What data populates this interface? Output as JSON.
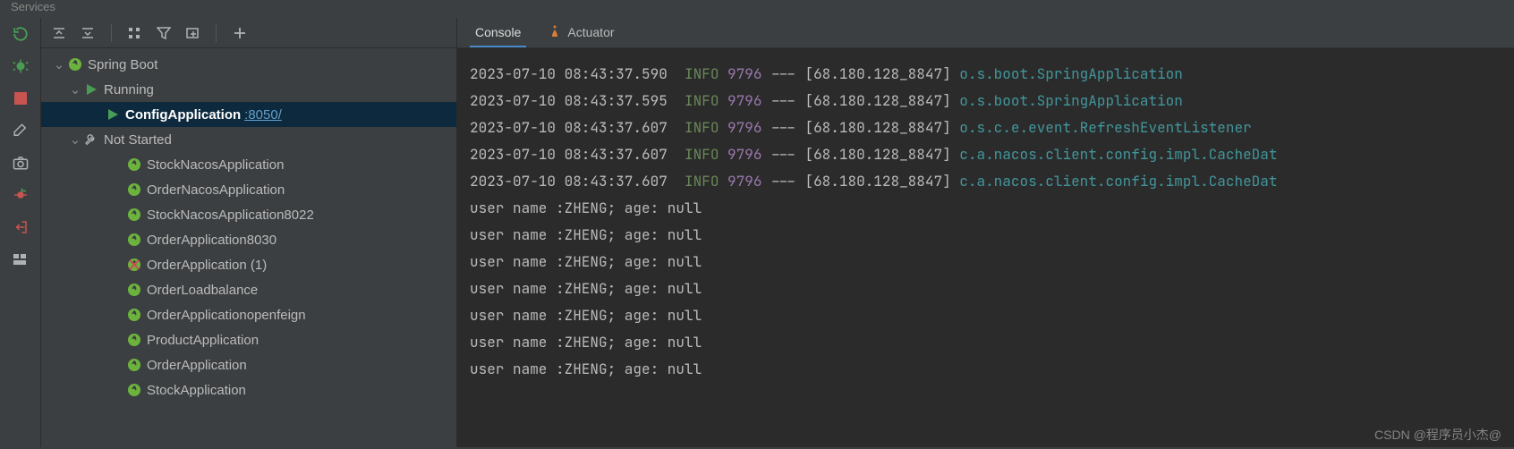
{
  "title": "Services",
  "tree": {
    "root": {
      "label": "Spring Boot"
    },
    "running": {
      "label": "Running"
    },
    "running_app": {
      "label": "ConfigApplication",
      "port": ":8050/"
    },
    "notstarted": {
      "label": "Not Started"
    },
    "apps": [
      {
        "label": "StockNacosApplication"
      },
      {
        "label": "OrderNacosApplication"
      },
      {
        "label": "StockNacosApplication8022"
      },
      {
        "label": "OrderApplication8030"
      },
      {
        "label": "OrderApplication (1)"
      },
      {
        "label": "OrderLoadbalance"
      },
      {
        "label": "OrderApplicationopenfeign"
      },
      {
        "label": "ProductApplication"
      },
      {
        "label": "OrderApplication"
      },
      {
        "label": "StockApplication"
      }
    ]
  },
  "tabs": {
    "console": "Console",
    "actuator": "Actuator"
  },
  "log": {
    "lines": [
      {
        "ts": "2023-07-10 08:43:37.590",
        "level": "INFO",
        "pid": "9796",
        "sep": "---",
        "thread": "[68.180.128_8847]",
        "class": "o.s.boot.SpringApplication"
      },
      {
        "ts": "2023-07-10 08:43:37.595",
        "level": "INFO",
        "pid": "9796",
        "sep": "---",
        "thread": "[68.180.128_8847]",
        "class": "o.s.boot.SpringApplication"
      },
      {
        "ts": "2023-07-10 08:43:37.607",
        "level": "INFO",
        "pid": "9796",
        "sep": "---",
        "thread": "[68.180.128_8847]",
        "class": "o.s.c.e.event.RefreshEventListener"
      },
      {
        "ts": "2023-07-10 08:43:37.607",
        "level": "INFO",
        "pid": "9796",
        "sep": "---",
        "thread": "[68.180.128_8847]",
        "class": "c.a.nacos.client.config.impl.CacheDat"
      },
      {
        "ts": "2023-07-10 08:43:37.607",
        "level": "INFO",
        "pid": "9796",
        "sep": "---",
        "thread": "[68.180.128_8847]",
        "class": "c.a.nacos.client.config.impl.CacheDat"
      }
    ],
    "plain": [
      "user name :ZHENG; age: null",
      "user name :ZHENG; age: null",
      "user name :ZHENG; age: null",
      "user name :ZHENG; age: null",
      "user name :ZHENG; age: null",
      "user name :ZHENG; age: null",
      "user name :ZHENG; age: null"
    ]
  },
  "watermark": "CSDN @程序员小杰@"
}
